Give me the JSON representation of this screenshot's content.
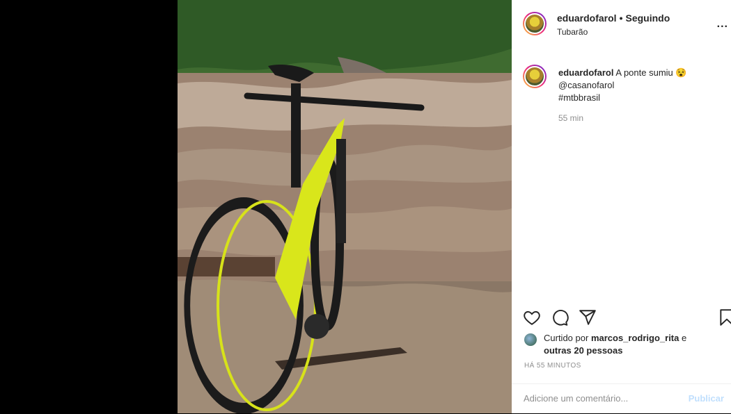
{
  "post": {
    "username": "eduardofarol",
    "separator": "•",
    "follow_status": "Seguindo",
    "location": "Tubarão",
    "more_label": "...",
    "caption_username": "eduardofarol",
    "caption_text": "A ponte sumiu 😵",
    "caption_mention": "@casanofarol",
    "caption_hashtag": "#mtbbrasil",
    "caption_time": "55 min",
    "liked_prefix": "Curtido por",
    "liked_user": "marcos_rodrigo_rita",
    "liked_and": "e",
    "liked_others": "outras 20 pessoas",
    "time_ago": "HÁ 55 MINUTOS",
    "comment_placeholder": "Adicione um comentário...",
    "publish_label": "Publicar"
  },
  "icons": [
    "heart-icon",
    "comment-icon",
    "share-icon",
    "bookmark-icon"
  ]
}
